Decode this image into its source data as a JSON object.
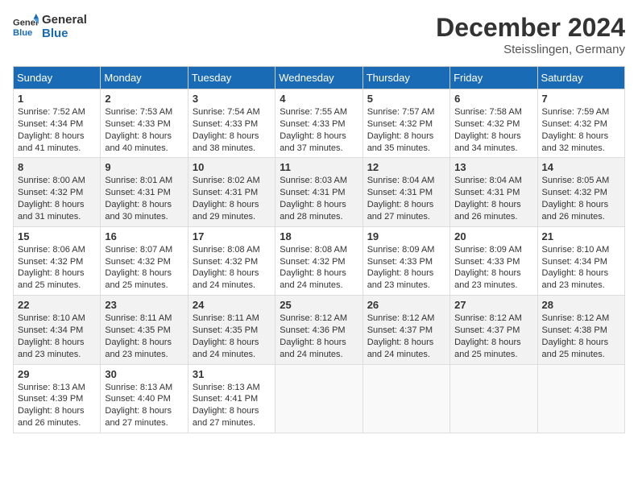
{
  "header": {
    "logo_line1": "General",
    "logo_line2": "Blue",
    "month": "December 2024",
    "location": "Steisslingen, Germany"
  },
  "days_of_week": [
    "Sunday",
    "Monday",
    "Tuesday",
    "Wednesday",
    "Thursday",
    "Friday",
    "Saturday"
  ],
  "weeks": [
    [
      {
        "day": 1,
        "sunrise": "7:52 AM",
        "sunset": "4:34 PM",
        "daylight": "8 hours and 41 minutes."
      },
      {
        "day": 2,
        "sunrise": "7:53 AM",
        "sunset": "4:33 PM",
        "daylight": "8 hours and 40 minutes."
      },
      {
        "day": 3,
        "sunrise": "7:54 AM",
        "sunset": "4:33 PM",
        "daylight": "8 hours and 38 minutes."
      },
      {
        "day": 4,
        "sunrise": "7:55 AM",
        "sunset": "4:33 PM",
        "daylight": "8 hours and 37 minutes."
      },
      {
        "day": 5,
        "sunrise": "7:57 AM",
        "sunset": "4:32 PM",
        "daylight": "8 hours and 35 minutes."
      },
      {
        "day": 6,
        "sunrise": "7:58 AM",
        "sunset": "4:32 PM",
        "daylight": "8 hours and 34 minutes."
      },
      {
        "day": 7,
        "sunrise": "7:59 AM",
        "sunset": "4:32 PM",
        "daylight": "8 hours and 32 minutes."
      }
    ],
    [
      {
        "day": 8,
        "sunrise": "8:00 AM",
        "sunset": "4:32 PM",
        "daylight": "8 hours and 31 minutes."
      },
      {
        "day": 9,
        "sunrise": "8:01 AM",
        "sunset": "4:31 PM",
        "daylight": "8 hours and 30 minutes."
      },
      {
        "day": 10,
        "sunrise": "8:02 AM",
        "sunset": "4:31 PM",
        "daylight": "8 hours and 29 minutes."
      },
      {
        "day": 11,
        "sunrise": "8:03 AM",
        "sunset": "4:31 PM",
        "daylight": "8 hours and 28 minutes."
      },
      {
        "day": 12,
        "sunrise": "8:04 AM",
        "sunset": "4:31 PM",
        "daylight": "8 hours and 27 minutes."
      },
      {
        "day": 13,
        "sunrise": "8:04 AM",
        "sunset": "4:31 PM",
        "daylight": "8 hours and 26 minutes."
      },
      {
        "day": 14,
        "sunrise": "8:05 AM",
        "sunset": "4:32 PM",
        "daylight": "8 hours and 26 minutes."
      }
    ],
    [
      {
        "day": 15,
        "sunrise": "8:06 AM",
        "sunset": "4:32 PM",
        "daylight": "8 hours and 25 minutes."
      },
      {
        "day": 16,
        "sunrise": "8:07 AM",
        "sunset": "4:32 PM",
        "daylight": "8 hours and 25 minutes."
      },
      {
        "day": 17,
        "sunrise": "8:08 AM",
        "sunset": "4:32 PM",
        "daylight": "8 hours and 24 minutes."
      },
      {
        "day": 18,
        "sunrise": "8:08 AM",
        "sunset": "4:32 PM",
        "daylight": "8 hours and 24 minutes."
      },
      {
        "day": 19,
        "sunrise": "8:09 AM",
        "sunset": "4:33 PM",
        "daylight": "8 hours and 23 minutes."
      },
      {
        "day": 20,
        "sunrise": "8:09 AM",
        "sunset": "4:33 PM",
        "daylight": "8 hours and 23 minutes."
      },
      {
        "day": 21,
        "sunrise": "8:10 AM",
        "sunset": "4:34 PM",
        "daylight": "8 hours and 23 minutes."
      }
    ],
    [
      {
        "day": 22,
        "sunrise": "8:10 AM",
        "sunset": "4:34 PM",
        "daylight": "8 hours and 23 minutes."
      },
      {
        "day": 23,
        "sunrise": "8:11 AM",
        "sunset": "4:35 PM",
        "daylight": "8 hours and 23 minutes."
      },
      {
        "day": 24,
        "sunrise": "8:11 AM",
        "sunset": "4:35 PM",
        "daylight": "8 hours and 24 minutes."
      },
      {
        "day": 25,
        "sunrise": "8:12 AM",
        "sunset": "4:36 PM",
        "daylight": "8 hours and 24 minutes."
      },
      {
        "day": 26,
        "sunrise": "8:12 AM",
        "sunset": "4:37 PM",
        "daylight": "8 hours and 24 minutes."
      },
      {
        "day": 27,
        "sunrise": "8:12 AM",
        "sunset": "4:37 PM",
        "daylight": "8 hours and 25 minutes."
      },
      {
        "day": 28,
        "sunrise": "8:12 AM",
        "sunset": "4:38 PM",
        "daylight": "8 hours and 25 minutes."
      }
    ],
    [
      {
        "day": 29,
        "sunrise": "8:13 AM",
        "sunset": "4:39 PM",
        "daylight": "8 hours and 26 minutes."
      },
      {
        "day": 30,
        "sunrise": "8:13 AM",
        "sunset": "4:40 PM",
        "daylight": "8 hours and 27 minutes."
      },
      {
        "day": 31,
        "sunrise": "8:13 AM",
        "sunset": "4:41 PM",
        "daylight": "8 hours and 27 minutes."
      },
      null,
      null,
      null,
      null
    ]
  ],
  "labels": {
    "sunrise": "Sunrise:",
    "sunset": "Sunset:",
    "daylight": "Daylight:"
  }
}
